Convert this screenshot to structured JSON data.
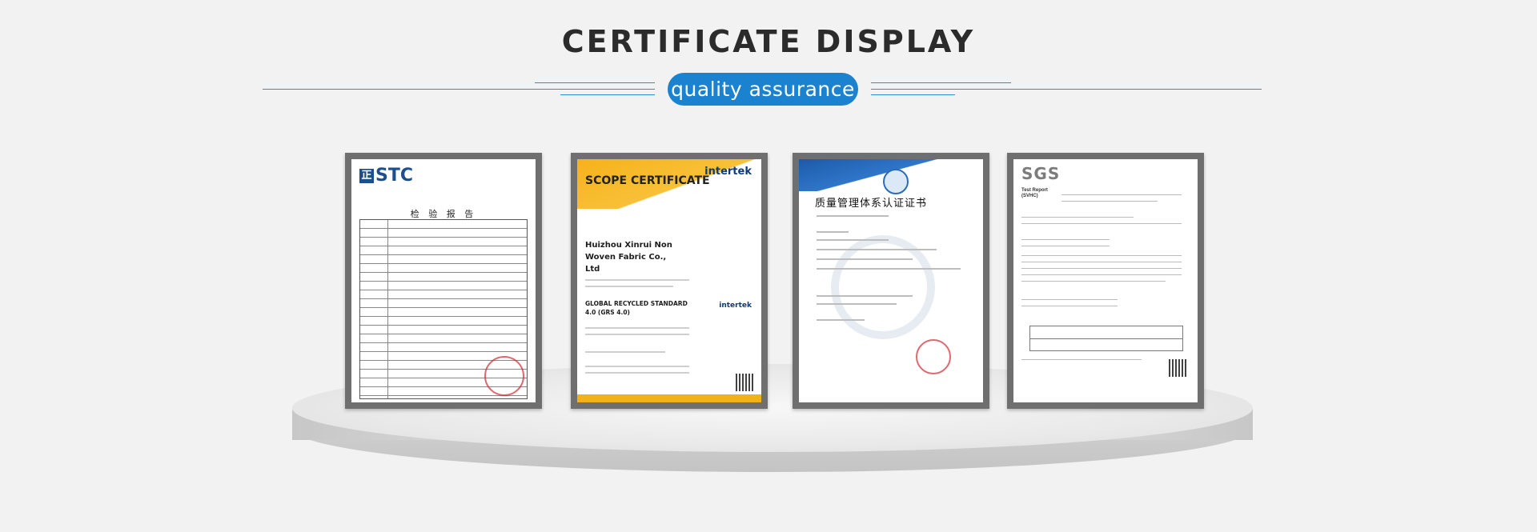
{
  "header": {
    "title": "CERTIFICATE DISPLAY",
    "badge": "quality assurance"
  },
  "colors": {
    "accent": "#1b82d0",
    "rule": "#2c8fd0",
    "frame": "#6f6f6f",
    "background": "#f2f2f2"
  },
  "certificates": [
    {
      "name": "stc-certificate",
      "logo": "STC",
      "logo_mark": "正",
      "title": "检 验 报 告"
    },
    {
      "name": "intertek-scope-certificate",
      "heading": "SCOPE CERTIFICATE",
      "brand": "intertek",
      "company": "Huizhou Xinrui Non Woven Fabric Co., Ltd",
      "standard": "GLOBAL RECYCLED STANDARD 4.0 (GRS 4.0)"
    },
    {
      "name": "quality-management-certificate",
      "title": "质量管理体系认证证书"
    },
    {
      "name": "sgs-test-report",
      "logo": "SGS",
      "subtitle": "Test Report (SVHC)"
    }
  ]
}
